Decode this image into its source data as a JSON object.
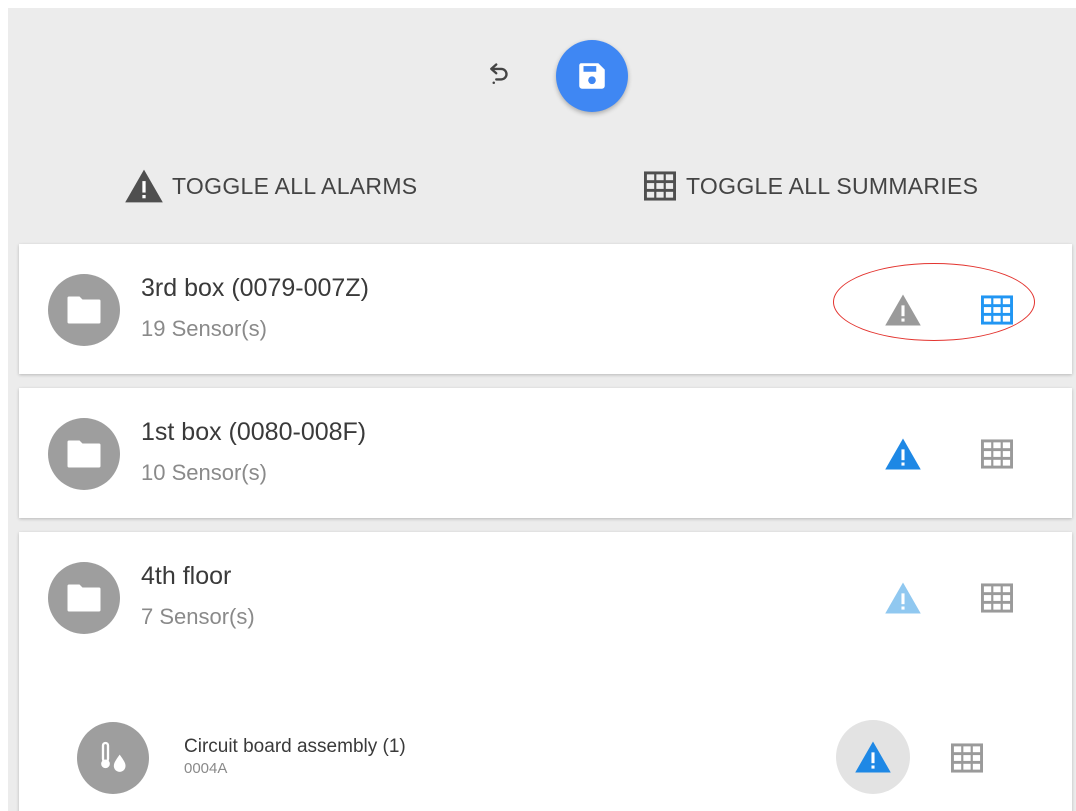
{
  "toolbar": {
    "undo_icon": "undo-icon",
    "save_icon": "floppy-disk-icon",
    "save_color": "#3f87f3"
  },
  "toggles": {
    "alarms_label": "TOGGLE ALL ALARMS",
    "summaries_label": "TOGGLE ALL SUMMARIES"
  },
  "colors": {
    "alarm_active": "#1e88e5",
    "alarm_faded": "#90c8f0",
    "alarm_inactive": "#9a9a9a",
    "summary_active": "#2196f3",
    "summary_inactive": "#9a9a9a",
    "highlight": "#e3342f"
  },
  "groups": [
    {
      "title": "3rd box (0079-007Z)",
      "subtitle": "19 Sensor(s)",
      "alarm_state": "inactive",
      "summary_state": "active",
      "highlighted": true
    },
    {
      "title": "1st box (0080-008F)",
      "subtitle": "10 Sensor(s)",
      "alarm_state": "active",
      "summary_state": "inactive"
    },
    {
      "title": "4th floor",
      "subtitle": "7 Sensor(s)",
      "alarm_state": "faded",
      "summary_state": "inactive"
    }
  ],
  "sensor": {
    "title": "Circuit board assembly (1)",
    "subtitle": "0004A",
    "icon": "thermometer-droplet-icon",
    "alarm_state": "active",
    "summary_state": "inactive"
  }
}
